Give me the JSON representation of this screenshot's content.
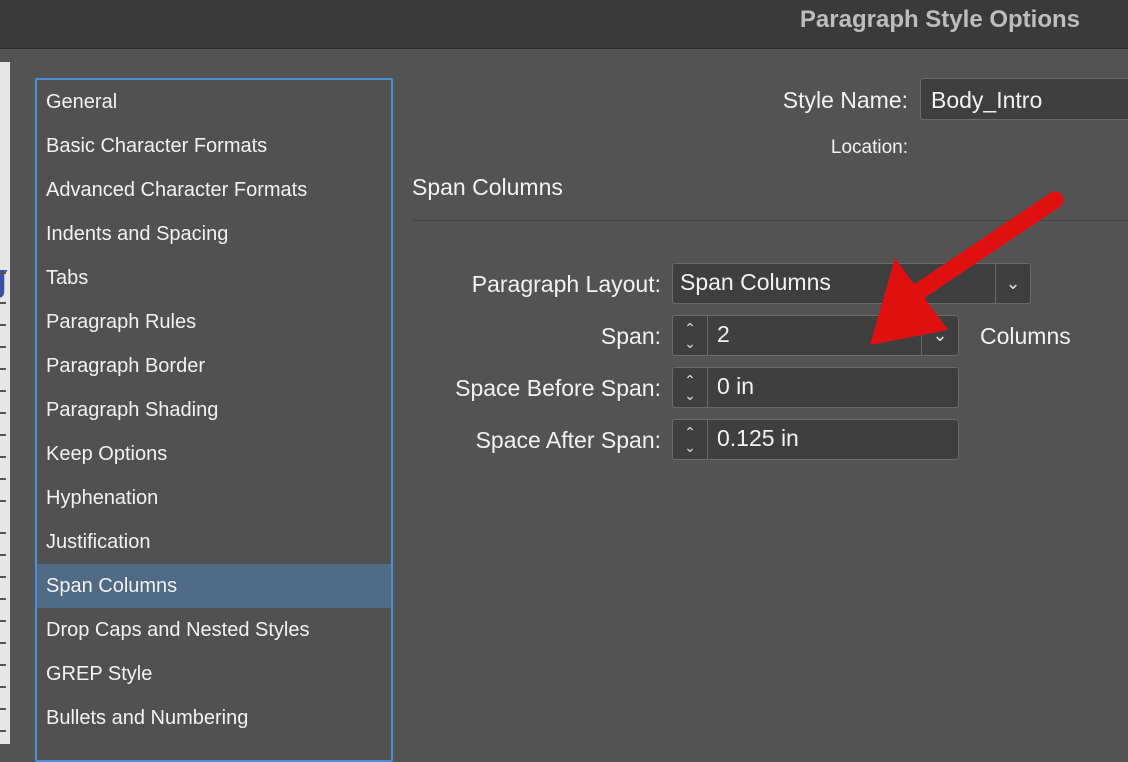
{
  "window": {
    "title": "Paragraph Style Options"
  },
  "sidebar": {
    "items": [
      {
        "label": "General"
      },
      {
        "label": "Basic Character Formats"
      },
      {
        "label": "Advanced Character Formats"
      },
      {
        "label": "Indents and Spacing"
      },
      {
        "label": "Tabs"
      },
      {
        "label": "Paragraph Rules"
      },
      {
        "label": "Paragraph Border"
      },
      {
        "label": "Paragraph Shading"
      },
      {
        "label": "Keep Options"
      },
      {
        "label": "Hyphenation"
      },
      {
        "label": "Justification"
      },
      {
        "label": "Span Columns"
      },
      {
        "label": "Drop Caps and Nested Styles"
      },
      {
        "label": "GREP Style"
      },
      {
        "label": "Bullets and Numbering"
      }
    ],
    "selected": "Span Columns"
  },
  "header": {
    "style_name_label": "Style Name:",
    "style_name_value": "Body_Intro",
    "location_label": "Location:"
  },
  "section": {
    "title": "Span Columns"
  },
  "form": {
    "paragraph_layout_label": "Paragraph Layout:",
    "paragraph_layout_value": "Span Columns",
    "span_label": "Span:",
    "span_value": "2",
    "span_unit": "Columns",
    "space_before_label": "Space Before Span:",
    "space_before_value": "0 in",
    "space_after_label": "Space After Span:",
    "space_after_value": "0.125 in"
  },
  "annotation": {
    "arrow_color": "#e01010"
  },
  "colors": {
    "selection": "#4f6a85",
    "focus_border": "#4a90d9"
  }
}
